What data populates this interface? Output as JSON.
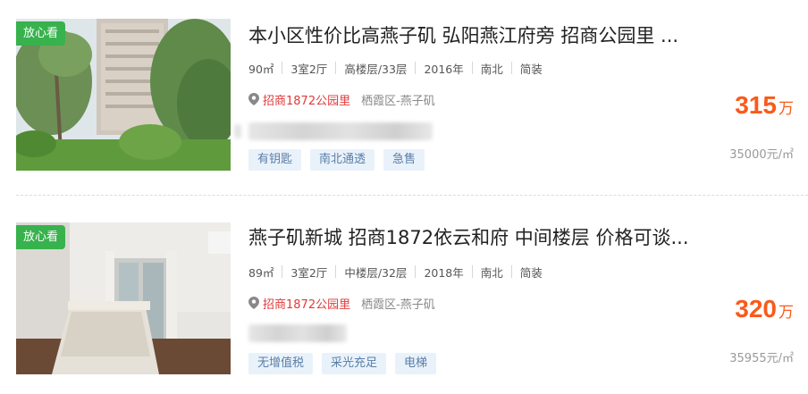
{
  "listings": [
    {
      "badge": "放心看",
      "title": "本小区性价比高燕子矶 弘阳燕江府旁 招商公园里 ...",
      "attrs": [
        "90㎡",
        "3室2厅",
        "高楼层/33层",
        "2016年",
        "南北",
        "简装"
      ],
      "community": "招商1872公园里",
      "district": "栖霞区-燕子矶",
      "tags": [
        "有钥匙",
        "南北通透",
        "急售"
      ],
      "price": "315",
      "price_unit": "万",
      "unit_price": "35000元/㎡",
      "image_icon": "photo-outdoor-garden"
    },
    {
      "badge": "放心看",
      "title": "燕子矶新城 招商1872依云和府 中间楼层 价格可谈...",
      "attrs": [
        "89㎡",
        "3室2厅",
        "中楼层/32层",
        "2018年",
        "南北",
        "简装"
      ],
      "community": "招商1872公园里",
      "district": "栖霞区-燕子矶",
      "tags": [
        "无增值税",
        "采光充足",
        "电梯"
      ],
      "price": "320",
      "price_unit": "万",
      "unit_price": "35955元/㎡",
      "image_icon": "photo-bedroom"
    }
  ],
  "colors": {
    "badge": "#37b24d",
    "price": "#fa5a1a",
    "community": "#e03a3a",
    "tag_bg": "#e9f2fb",
    "tag_text": "#5a7ea6"
  }
}
